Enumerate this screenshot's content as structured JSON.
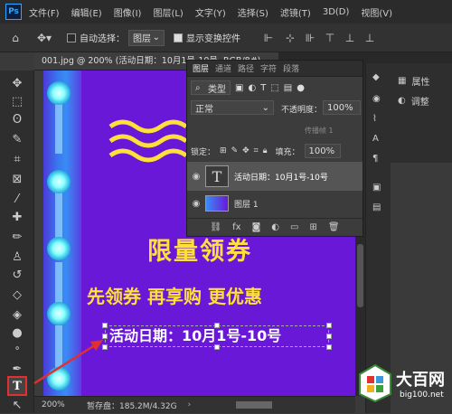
{
  "app": {
    "logo": "Ps"
  },
  "menu": [
    "文件(F)",
    "编辑(E)",
    "图像(I)",
    "图层(L)",
    "文字(Y)",
    "选择(S)",
    "滤镜(T)",
    "3D(D)",
    "视图(V)"
  ],
  "options_bar": {
    "auto_select_label": "自动选择：",
    "auto_select_value": "图层",
    "show_transform_label": "显示变换控件"
  },
  "document": {
    "tab_title": "001.jpg @ 200% (活动日期：10月1号-10号, RGB/8#)"
  },
  "canvas": {
    "title": "限量领券",
    "subtitle": "先领券 再享购 更优惠",
    "date_text": "活动日期：10月1号-10号"
  },
  "status": {
    "zoom": "200%",
    "scratch": "暂存盘：185.2M/4.32G"
  },
  "layers_panel": {
    "tabs": [
      "图层",
      "通道",
      "路径",
      "字符",
      "段落"
    ],
    "filter_kind": "类型",
    "blend_mode": "正常",
    "opacity_label": "不透明度：",
    "opacity_value": "100%",
    "lock_label": "锁定：",
    "propagate_label": "传播帧 1",
    "fill_label": "填充：",
    "fill_value": "100%",
    "layers": [
      {
        "name": "活动日期：10月1号-10号",
        "type": "text"
      },
      {
        "name": "图层 1",
        "type": "image"
      }
    ]
  },
  "right_panel": {
    "properties": "属性",
    "adjustments": "调整"
  },
  "watermark": {
    "title": "大百网",
    "url": "big100.net"
  },
  "colors": {
    "canvas_bg": "#6a18d8",
    "headline": "#ffe03a",
    "highlight": "#e03030"
  }
}
